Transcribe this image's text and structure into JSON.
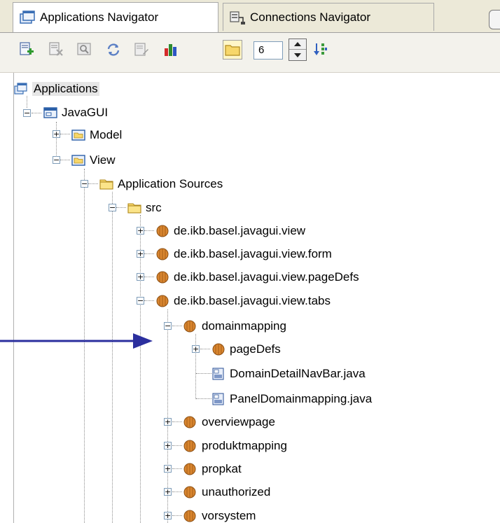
{
  "tabs": [
    {
      "label": "Applications Navigator",
      "active": true,
      "icon": "applications-navigator-icon"
    },
    {
      "label": "Connections Navigator",
      "active": false,
      "icon": "connections-navigator-icon"
    }
  ],
  "toolbar": {
    "buttons": [
      {
        "name": "new-application-icon"
      },
      {
        "name": "delete-icon"
      },
      {
        "name": "find-icon"
      },
      {
        "name": "refresh-icon"
      },
      {
        "name": "properties-icon"
      },
      {
        "name": "statistics-icon"
      },
      {
        "name": "show-folders-icon",
        "pressed": true
      }
    ],
    "level_value": "6",
    "sort_icon": "sort-icon"
  },
  "tree": [
    {
      "label": "Applications",
      "depth": 0,
      "icon": "applications-root-icon",
      "selected": true
    },
    {
      "label": "JavaGUI",
      "depth": 1,
      "icon": "application-icon",
      "toggle": "-"
    },
    {
      "label": "Model",
      "depth": 2,
      "icon": "project-icon",
      "toggle": "+"
    },
    {
      "label": "View",
      "depth": 2,
      "icon": "project-icon",
      "toggle": "-"
    },
    {
      "label": "Application Sources",
      "depth": 3,
      "icon": "folder-icon",
      "toggle": "-"
    },
    {
      "label": "src",
      "depth": 4,
      "icon": "folder-icon",
      "toggle": "-"
    },
    {
      "label": "de.ikb.basel.javagui.view",
      "depth": 5,
      "icon": "package-icon",
      "toggle": "+"
    },
    {
      "label": "de.ikb.basel.javagui.view.form",
      "depth": 5,
      "icon": "package-icon",
      "toggle": "+"
    },
    {
      "label": "de.ikb.basel.javagui.view.pageDefs",
      "depth": 5,
      "icon": "package-icon",
      "toggle": "+"
    },
    {
      "label": "de.ikb.basel.javagui.view.tabs",
      "depth": 5,
      "icon": "package-icon",
      "toggle": "-"
    },
    {
      "label": "domainmapping",
      "depth": 6,
      "icon": "package-icon",
      "toggle": "-"
    },
    {
      "label": "pageDefs",
      "depth": 7,
      "icon": "package-icon",
      "toggle": "+"
    },
    {
      "label": "DomainDetailNavBar.java",
      "depth": 7,
      "icon": "java-file-icon"
    },
    {
      "label": "PanelDomainmapping.java",
      "depth": 7,
      "icon": "java-file-icon"
    },
    {
      "label": "overviewpage",
      "depth": 6,
      "icon": "package-icon",
      "toggle": "+"
    },
    {
      "label": "produktmapping",
      "depth": 6,
      "icon": "package-icon",
      "toggle": "+"
    },
    {
      "label": "propkat",
      "depth": 6,
      "icon": "package-icon",
      "toggle": "+"
    },
    {
      "label": "unauthorized",
      "depth": 6,
      "icon": "package-icon",
      "toggle": "+"
    },
    {
      "label": "vorsystem",
      "depth": 6,
      "icon": "package-icon",
      "toggle": "+"
    }
  ],
  "annotation": {
    "name": "pointer-arrow",
    "color": "#2b2f9e"
  }
}
